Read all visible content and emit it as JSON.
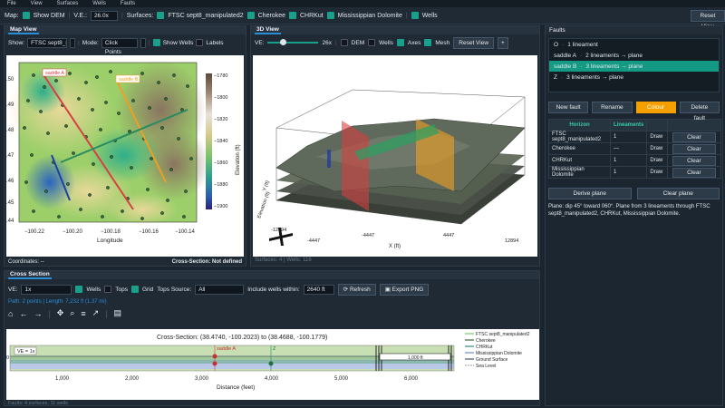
{
  "menu": [
    "File",
    "View",
    "Surfaces",
    "Wells",
    "Faults"
  ],
  "toolbar": {
    "map_label": "Map:",
    "show_dem": "Show DEM",
    "ve_label": "V.E.:",
    "ve_value": "26.0x",
    "surfaces_label": "Surfaces:",
    "surface_items": [
      "FTSC sept8_manipulated2",
      "Cherokee",
      "CHRKut",
      "Mississippian Dolomite"
    ],
    "wells": "Wells",
    "reset_view": "Reset View"
  },
  "map_view": {
    "title": "Map View",
    "show_label": "Show:",
    "show_value": "FTSC sept8_man",
    "mode_label": "Mode:",
    "mode_value": "Click Points",
    "show_wells": "Show Wells",
    "labels": "Labels",
    "xlabel": "Longitude",
    "xticks": [
      "−100.22",
      "−100.20",
      "−100.18",
      "−100.16",
      "−100.14"
    ],
    "yticks": [
      ".50",
      ".49",
      ".48",
      ".47",
      ".46",
      ".45",
      ".44"
    ],
    "cbar_label": "Elevation (ft)",
    "cbar_ticks": [
      "−1780",
      "−1800",
      "−1820",
      "−1840",
      "−1860",
      "−1880",
      "−1900"
    ],
    "lines": [
      "saddle A",
      "saddle B"
    ],
    "coordinates": "Coordinates: --",
    "cross_section_status": "Cross-Section: Not defined"
  },
  "view3d": {
    "title": "3D View",
    "ve_label": "VE:",
    "ve_value": "26x",
    "dem": "DEM",
    "wells": "Wells",
    "axes": "Axes",
    "mesh": "Mesh",
    "reset": "Reset View",
    "plus": "+",
    "x_ticks": [
      "-4447",
      "4447",
      "12894"
    ],
    "x_label": "X (ft)",
    "y_ticks": [
      "-12894",
      "-4447"
    ],
    "y_label": "Y (ft)",
    "z_label": "Elevation (ft)",
    "status": "Surfaces: 4 | Wells: 116"
  },
  "faults": {
    "title": "Faults",
    "items": [
      {
        "name": "O",
        "desc": "1 lineament",
        "selected": false
      },
      {
        "name": "saddle A",
        "desc": "2 lineaments → plane",
        "selected": false
      },
      {
        "name": "saddle B",
        "desc": "3 lineaments → plane",
        "selected": true
      },
      {
        "name": "Z",
        "desc": "3 lineaments → plane",
        "selected": false
      }
    ],
    "new_fault": "New fault",
    "rename": "Rename",
    "colour": "Colour",
    "delete": "Delete fault",
    "col_horizon": "Horizon",
    "col_lineaments": "Lineaments",
    "rows": [
      {
        "h": "FTSC sept8_manipulated2",
        "n": "1",
        "draw": "Draw",
        "clear": "Clear"
      },
      {
        "h": "Cherokee",
        "n": "—",
        "draw": "Draw",
        "clear": "Clear"
      },
      {
        "h": "CHRKut",
        "n": "1",
        "draw": "Draw",
        "clear": "Clear"
      },
      {
        "h": "Mississippian Dolomite",
        "n": "1",
        "draw": "Draw",
        "clear": "Clear"
      }
    ],
    "derive": "Derive plane",
    "clear_plane": "Clear plane",
    "description": "Plane: dip 45° toward 060°. Plane from 3 lineaments through FTSC sept8_manipulated2, CHRKut, Mississippian Dolomite."
  },
  "cross_section": {
    "title": "Cross Section",
    "ve_label": "VE:",
    "ve_value": "1x",
    "wells": "Wells",
    "tops": "Tops",
    "grid": "Grid",
    "tops_source_label": "Tops Source:",
    "tops_source_value": "All",
    "include_label": "Include wells within:",
    "include_value": "2640 ft",
    "refresh": "Refresh",
    "export": "Export PNG",
    "path_info": "Path: 2 points | Length: 7,232 ft (1.37 mi)",
    "plot_title": "Cross-Section: (38.4740, -100.2023) to (38.4688, -100.1779)",
    "ve_box": "VE = 1x",
    "xlabel": "Distance (feet)",
    "xticks": [
      "1,000",
      "2,000",
      "3,000",
      "4,000",
      "5,000",
      "6,000"
    ],
    "scalebar": "1,000 ft",
    "markers": [
      "saddle A",
      "Z"
    ],
    "legend": [
      "FTSC sept8_manipulated2",
      "Cherokee",
      "CHRKut",
      "Mississippian Dolomite",
      "Ground Surface",
      "Sea Level"
    ],
    "legend_colors": [
      "#7cc86c",
      "#3a6a3a",
      "#2f8a8a",
      "#6a8acb",
      "#4a5a6a",
      "#9a9a9a"
    ],
    "footer": "Faults: 4 surfaces, 11 wells"
  }
}
